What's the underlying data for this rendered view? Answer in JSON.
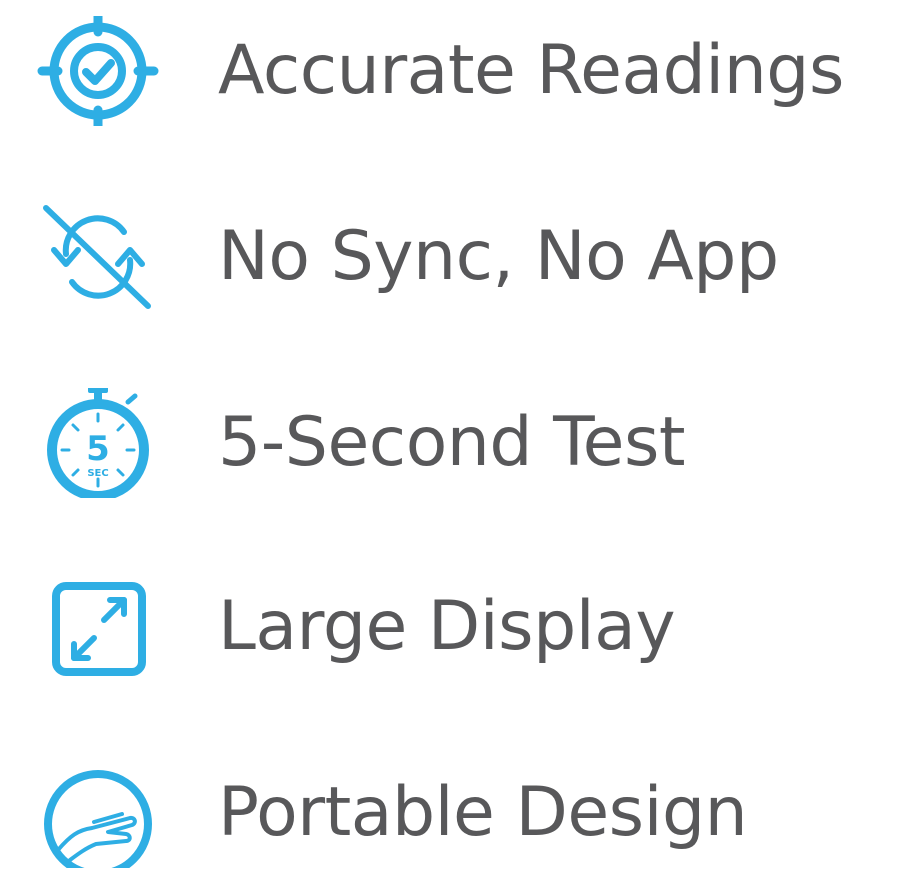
{
  "colors": {
    "accent": "#2eaee4",
    "text": "#58585a"
  },
  "features": [
    {
      "label": "Accurate Readings",
      "icon": "target-check-icon"
    },
    {
      "label": "No Sync, No App",
      "icon": "no-sync-icon"
    },
    {
      "label": "5-Second Test",
      "icon": "stopwatch-icon",
      "icon_text": {
        "number": "5",
        "unit": "SEC"
      }
    },
    {
      "label": "Large Display",
      "icon": "expand-display-icon"
    },
    {
      "label": "Portable Design",
      "icon": "hand-icon"
    }
  ]
}
